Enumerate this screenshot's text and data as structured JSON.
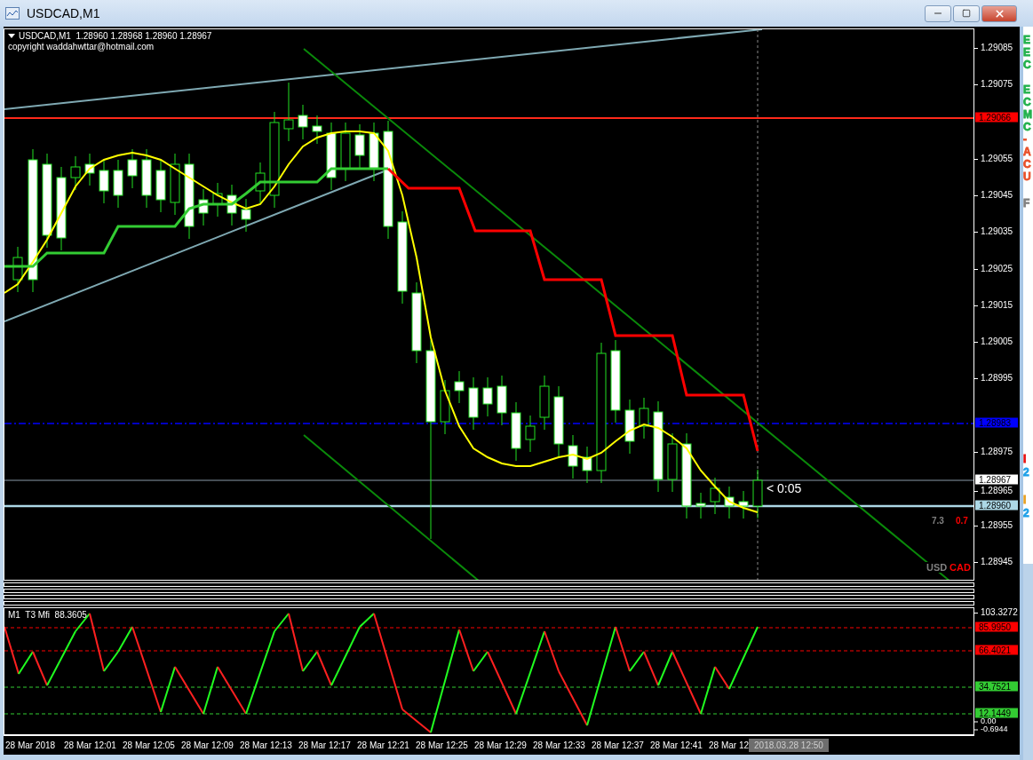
{
  "window": {
    "title": "USDCAD,M1"
  },
  "chart": {
    "symbol_line": "USDCAD,M1  1.28960 1.28968 1.28960 1.28967",
    "copyright": "copyright waddahwttar@hotmail.com",
    "countdown": "< 0:05",
    "stats": [
      {
        "text": "7.3",
        "color": "#808080"
      },
      {
        "text": "0.7",
        "color": "#ff0000"
      }
    ],
    "currency_pair": [
      {
        "text": "USD",
        "color": "#808080"
      },
      {
        "text": "CAD",
        "color": "#ff0000"
      }
    ],
    "price_ticks": [
      "1.29085",
      "1.29075",
      "1.29055",
      "1.29045",
      "1.29035",
      "1.29025",
      "1.29015",
      "1.29005",
      "1.28995",
      "1.28975",
      "1.28965",
      "1.28955",
      "1.28945"
    ],
    "price_marks": [
      {
        "text": "1.29066",
        "color": "#ff0000"
      },
      {
        "text": "1.28983",
        "color": "#0000ff"
      },
      {
        "text": "1.28967",
        "color": "#ffffff"
      },
      {
        "text": "1.28960",
        "color": "#add8e6"
      }
    ]
  },
  "indicator": {
    "title": "M1  T3 Mfi  88.3605",
    "scale": [
      "103.3272",
      "0.00",
      "-0.6944"
    ],
    "levels": [
      {
        "text": "85.9950",
        "color": "#ff0000"
      },
      {
        "text": "66.4021",
        "color": "#ff0000"
      },
      {
        "text": "34.7521",
        "color": "#33cc33"
      },
      {
        "text": "12.1449",
        "color": "#33cc33"
      }
    ]
  },
  "time_axis": {
    "labels": [
      "28 Mar 2018",
      "28 Mar 12:01",
      "28 Mar 12:05",
      "28 Mar 12:09",
      "28 Mar 12:13",
      "28 Mar 12:17",
      "28 Mar 12:21",
      "28 Mar 12:25",
      "28 Mar 12:29",
      "28 Mar 12:33",
      "28 Mar 12:37",
      "28 Mar 12:41",
      "28 Mar 12"
    ],
    "cursor_label": "2018.03.28 12:50"
  },
  "side_letters": [
    {
      "text": "E",
      "color": "#22b14c"
    },
    {
      "text": "E",
      "color": "#22b14c"
    },
    {
      "text": "C",
      "color": "#22b14c"
    },
    {
      "text": "E",
      "color": "#22b14c"
    },
    {
      "text": "C",
      "color": "#22b14c"
    },
    {
      "text": "M",
      "color": "#22b14c"
    },
    {
      "text": "C",
      "color": "#22b14c"
    },
    {
      "text": "-",
      "color": "#e8502a"
    },
    {
      "text": "A",
      "color": "#e8502a"
    },
    {
      "text": "C",
      "color": "#e8502a"
    },
    {
      "text": "U",
      "color": "#e8502a"
    },
    {
      "text": "F",
      "color": "#808080"
    },
    {
      "text": "I",
      "color": "#e81010"
    },
    {
      "text": "2",
      "color": "#1ea0e8"
    },
    {
      "text": "I",
      "color": "#e8a020"
    },
    {
      "text": "2",
      "color": "#1ea0e8"
    }
  ]
}
